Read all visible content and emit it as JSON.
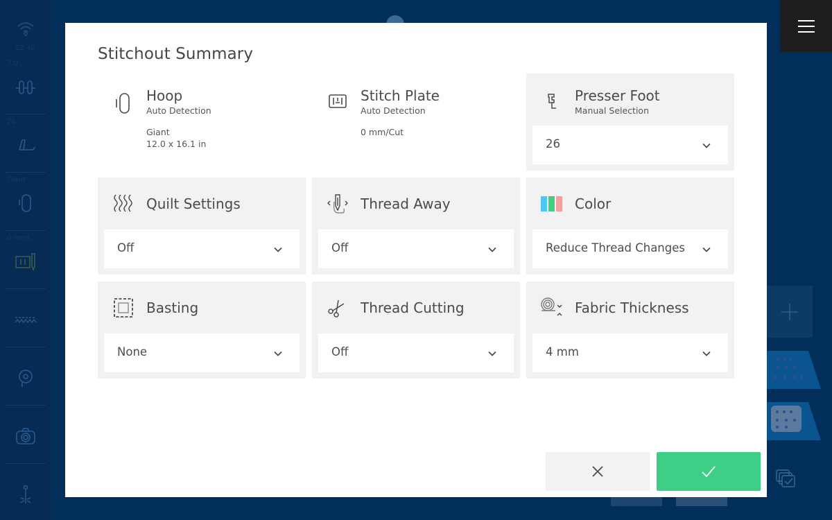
{
  "background": {
    "sidebar": {
      "status_time": "22:40",
      "items": [
        {
          "label": "3.0",
          "icon": "stitch-width-icon"
        },
        {
          "label": "26",
          "icon": "presser-foot-icon"
        },
        {
          "label": "Giant",
          "icon": "hoop-icon"
        },
        {
          "label": "0 mm/...",
          "icon": "stitch-plate-needle-icon"
        },
        {
          "label": "",
          "icon": "feed-dogs-icon"
        },
        {
          "label": "",
          "icon": "bobbin-icon"
        },
        {
          "label": "",
          "icon": "camera-icon"
        },
        {
          "label": "",
          "icon": "needle-light-icon"
        }
      ]
    },
    "menu_icon": "hamburger-menu-icon",
    "add_icon": "plus-icon"
  },
  "dialog": {
    "title": "Stitchout Summary",
    "info_cards": [
      {
        "title": "Hoop",
        "subtitle": "Auto Detection",
        "values": [
          "Giant",
          "12.0 x 16.1 in"
        ],
        "icon": "hoop-icon"
      },
      {
        "title": "Stitch Plate",
        "subtitle": "Auto Detection",
        "values": [
          "0 mm/Cut"
        ],
        "icon": "stitch-plate-icon"
      }
    ],
    "presser_foot": {
      "title": "Presser Foot",
      "subtitle": "Manual Selection",
      "value": "26",
      "icon": "presser-foot-icon"
    },
    "settings": [
      {
        "title": "Quilt Settings",
        "value": "Off",
        "icon": "quilt-icon"
      },
      {
        "title": "Thread Away",
        "value": "Off",
        "icon": "thread-away-icon"
      },
      {
        "title": "Color",
        "value": "Reduce Thread Changes",
        "icon": "color-icon",
        "swatches": [
          "#4cc9f0",
          "#3ecf86",
          "#f4a0a0"
        ]
      },
      {
        "title": "Basting",
        "value": "None",
        "icon": "basting-icon"
      },
      {
        "title": "Thread Cutting",
        "value": "Off",
        "icon": "scissors-icon"
      },
      {
        "title": "Fabric Thickness",
        "value": "4 mm",
        "icon": "fabric-thickness-icon"
      }
    ],
    "buttons": {
      "cancel": {
        "icon": "close-icon"
      },
      "confirm": {
        "icon": "checkmark-icon",
        "color": "#3ecf86"
      }
    }
  }
}
